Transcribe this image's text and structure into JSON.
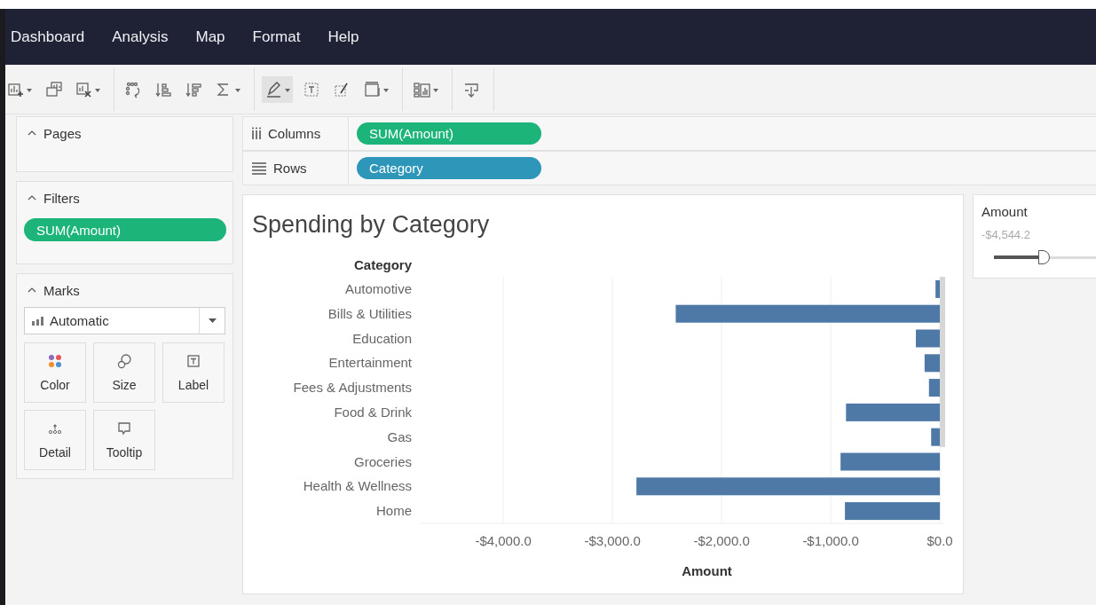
{
  "menu": [
    "Dashboard",
    "Analysis",
    "Map",
    "Format",
    "Help"
  ],
  "toolbar": [
    [
      {
        "dropdown": true,
        "selected": false
      },
      {
        "dropdown": false,
        "selected": false
      },
      {
        "dropdown": true,
        "selected": false
      }
    ],
    [
      {
        "dropdown": false,
        "selected": false
      },
      {
        "dropdown": false,
        "selected": false
      },
      {
        "dropdown": false,
        "selected": false
      },
      {
        "dropdown": true,
        "selected": false
      }
    ],
    [
      {
        "dropdown": true,
        "selected": true
      },
      {
        "dropdown": false,
        "selected": false
      },
      {
        "dropdown": false,
        "selected": false
      },
      {
        "dropdown": true,
        "selected": false
      }
    ],
    [
      {
        "dropdown": true,
        "selected": false
      }
    ],
    [
      {
        "dropdown": false,
        "selected": false
      }
    ]
  ],
  "pages": {
    "title": "Pages",
    "expanded": true
  },
  "filters": {
    "title": "Filters",
    "expanded": true,
    "pills": [
      {
        "text": "SUM(Amount)",
        "color": "#1db47a"
      }
    ]
  },
  "marks": {
    "title": "Marks",
    "expanded": true,
    "mark_type": "Automatic",
    "cards": [
      "Color",
      "Size",
      "Label",
      "Detail",
      "Tooltip"
    ]
  },
  "shelves": [
    {
      "label": "Columns",
      "pill": {
        "text": "SUM(Amount)",
        "color": "#1db47a"
      }
    },
    {
      "label": "Rows",
      "pill": {
        "text": "Category",
        "color": "#2e96b8"
      }
    }
  ],
  "view": {
    "title": "Spending by Category",
    "chart_data": {
      "type": "bar",
      "orientation": "horizontal",
      "xlabel": "Amount",
      "ylabel": "Category",
      "categories": [
        "Automotive",
        "Bills & Utilities",
        "Education",
        "Entertainment",
        "Fees & Adjustments",
        "Food & Drink",
        "Gas",
        "Groceries",
        "Health & Wellness",
        "Home"
      ],
      "series": [
        {
          "color": "#4e79a7",
          "values": [
            -40,
            -2420,
            -220,
            -140,
            -100,
            -860,
            -80,
            -910,
            -2780,
            -870
          ]
        }
      ],
      "grid": true,
      "xlim": [
        -4765,
        40
      ],
      "xticks": [
        {
          "value": -4000,
          "label": "-$4,000.0"
        },
        {
          "value": -3000,
          "label": "-$3,000.0"
        },
        {
          "value": -2000,
          "label": "-$2,000.0"
        },
        {
          "value": -1000,
          "label": "-$1,000.0"
        },
        {
          "value": 0,
          "label": "$0.0"
        }
      ]
    }
  },
  "filter_card": {
    "title": "Amount",
    "value": "-$4,544.2",
    "level": 0.45
  }
}
